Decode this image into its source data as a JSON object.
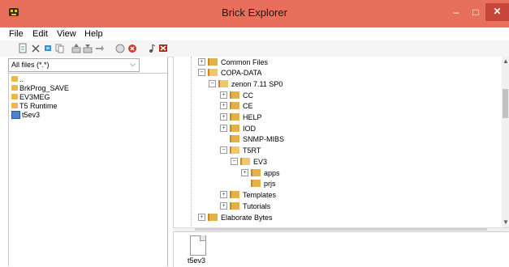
{
  "window": {
    "title": "Brick Explorer",
    "controls": {
      "minimize": "–",
      "maximize": "□",
      "close": "✕"
    }
  },
  "menu": [
    "File",
    "Edit",
    "View",
    "Help"
  ],
  "toolbar": {
    "icons": [
      "new-file-icon",
      "delete-icon",
      "tool-icon",
      "copy-icon",
      "upload-icon",
      "download-icon",
      "arrow-icon",
      "stop-icon",
      "cancel-icon",
      "music-icon",
      "close-program-icon"
    ]
  },
  "left_pane": {
    "filter_value": "All files (*.*)",
    "items": [
      {
        "label": "..",
        "icon": "folder"
      },
      {
        "label": "BrkProg_SAVE",
        "icon": "folder"
      },
      {
        "label": "EV3MEG",
        "icon": "folder"
      },
      {
        "label": "T5 Runtime",
        "icon": "folder"
      },
      {
        "label": "t5ev3",
        "icon": "image"
      }
    ]
  },
  "tree": [
    {
      "label": "Common Files",
      "expander": "+"
    },
    {
      "label": "COPA-DATA",
      "expander": "−"
    },
    {
      "label": "zenon 7.11 SP0",
      "expander": "−"
    },
    {
      "label": "CC",
      "expander": "+"
    },
    {
      "label": "CE",
      "expander": "+"
    },
    {
      "label": "HELP",
      "expander": "+"
    },
    {
      "label": "IOD",
      "expander": "+"
    },
    {
      "label": "SNMP-MIBS",
      "expander": ""
    },
    {
      "label": "T5RT",
      "expander": "−"
    },
    {
      "label": "EV3",
      "expander": "−"
    },
    {
      "label": "apps",
      "expander": "+"
    },
    {
      "label": "prjs",
      "expander": ""
    },
    {
      "label": "Templates",
      "expander": "+"
    },
    {
      "label": "Tutorials",
      "expander": "+"
    },
    {
      "label": "Elaborate Bytes",
      "expander": "+"
    }
  ],
  "bottom_pane": {
    "file_label": "t5ev3"
  },
  "colors": {
    "titlebar": "#e86f5b",
    "close_button": "#c7453a",
    "folder": "#e4b048"
  }
}
